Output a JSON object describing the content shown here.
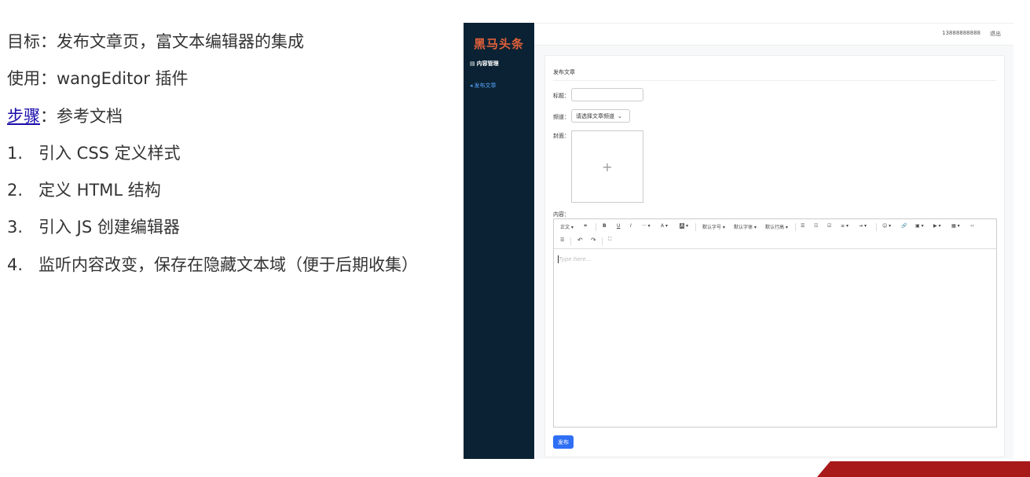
{
  "notes": {
    "goal": "目标：发布文章页，富文本编辑器的集成",
    "use": "使用：wangEditor 插件",
    "steps_link": "步骤",
    "steps_rest": "：参考文档",
    "list": [
      {
        "num": "1.",
        "text": "引入 CSS 定义样式"
      },
      {
        "num": "2.",
        "text": "定义 HTML 结构"
      },
      {
        "num": "3.",
        "text": "引入 JS 创建编辑器"
      },
      {
        "num": "4.",
        "text": "监听内容改变，保存在隐藏文本域（便于后期收集）"
      }
    ]
  },
  "app": {
    "logo": "黑马头条",
    "nav_group": "内容管理",
    "nav_item": "发布文章",
    "phone": "13888888888",
    "logout": "退出",
    "card_title": "发布文章",
    "title_label": "标题：",
    "channel_label": "频道：",
    "channel_placeholder": "请选择文章频道",
    "cover_label": "封面：",
    "cover_plus": "+",
    "content_label": "内容：",
    "editor_placeholder": "Type here...",
    "publish": "发布",
    "toolbar": {
      "text_style": "正文",
      "quote": "❝",
      "bold": "B",
      "underline": "U",
      "italic": "I",
      "more": "···",
      "font_color": "A",
      "bg_color": "A",
      "font_size": "默认字号",
      "font_family": "默认字体",
      "line_height": "默认行高",
      "bulleted_list": "☰",
      "numbered_list": "☷",
      "todo": "☑",
      "justify": "≡",
      "indent": "⇥",
      "emotion": "☺",
      "link": "🔗",
      "image": "▣",
      "video": "▶",
      "table": "▦",
      "code": "‹›",
      "divider": "☰",
      "undo": "↶",
      "redo": "↷",
      "fullscreen": "⛶"
    },
    "colors": {
      "sidebar": "#0a2233",
      "logo": "#e2603a",
      "nav_active": "#5aa7ff",
      "primary": "#2f6ff5"
    }
  }
}
